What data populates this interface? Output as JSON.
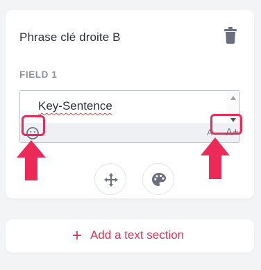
{
  "card": {
    "title": "Phrase clé droite B",
    "delete_icon": "trash-icon",
    "field": {
      "label": "FIELD 1",
      "value": "Key-Sentence",
      "emoji_icon": "smiley-icon",
      "font_decrease_label": "A-",
      "font_increase_label": "A+"
    },
    "move_icon": "move-arrows-icon",
    "color_icon": "palette-icon"
  },
  "add_section": {
    "plus": "+",
    "label": "Add a text section"
  },
  "annotations": {
    "highlight_color": "#ec2a57"
  },
  "colors": {
    "accent": "#e8304f",
    "text": "#2b2f3a",
    "muted": "#8a8fa3"
  }
}
